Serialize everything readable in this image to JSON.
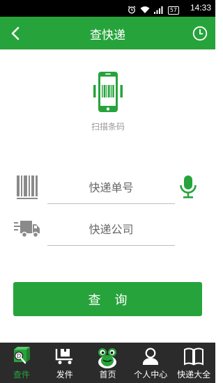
{
  "status_bar": {
    "time": "14:33",
    "battery": "57",
    "icons": [
      "alarm-icon",
      "wifi-icon",
      "signal-icon",
      "battery-icon"
    ]
  },
  "header": {
    "title": "查快递",
    "back_icon": "chevron-left-icon",
    "history_icon": "clock-icon"
  },
  "scan": {
    "label": "扫描条码",
    "icon": "phone-barcode-icon"
  },
  "form": {
    "tracking_number": {
      "placeholder": "快递单号",
      "value": "",
      "icon": "barcode-icon",
      "voice_icon": "microphone-icon"
    },
    "company": {
      "placeholder": "快递公司",
      "value": "",
      "icon": "truck-icon"
    }
  },
  "query_button": {
    "label": "查询"
  },
  "bottom_nav": {
    "items": [
      {
        "label": "查件",
        "icon": "search-parcel-icon",
        "active": true
      },
      {
        "label": "发件",
        "icon": "cart-package-icon",
        "active": false
      },
      {
        "label": "首页",
        "icon": "frog-mascot-icon",
        "active": false
      },
      {
        "label": "个人中心",
        "icon": "user-icon",
        "active": false
      },
      {
        "label": "快递大全",
        "icon": "book-icon",
        "active": false
      }
    ]
  },
  "colors": {
    "primary": "#27a33c",
    "nav_bg": "#2b2b2b",
    "status_bg": "#000000"
  }
}
